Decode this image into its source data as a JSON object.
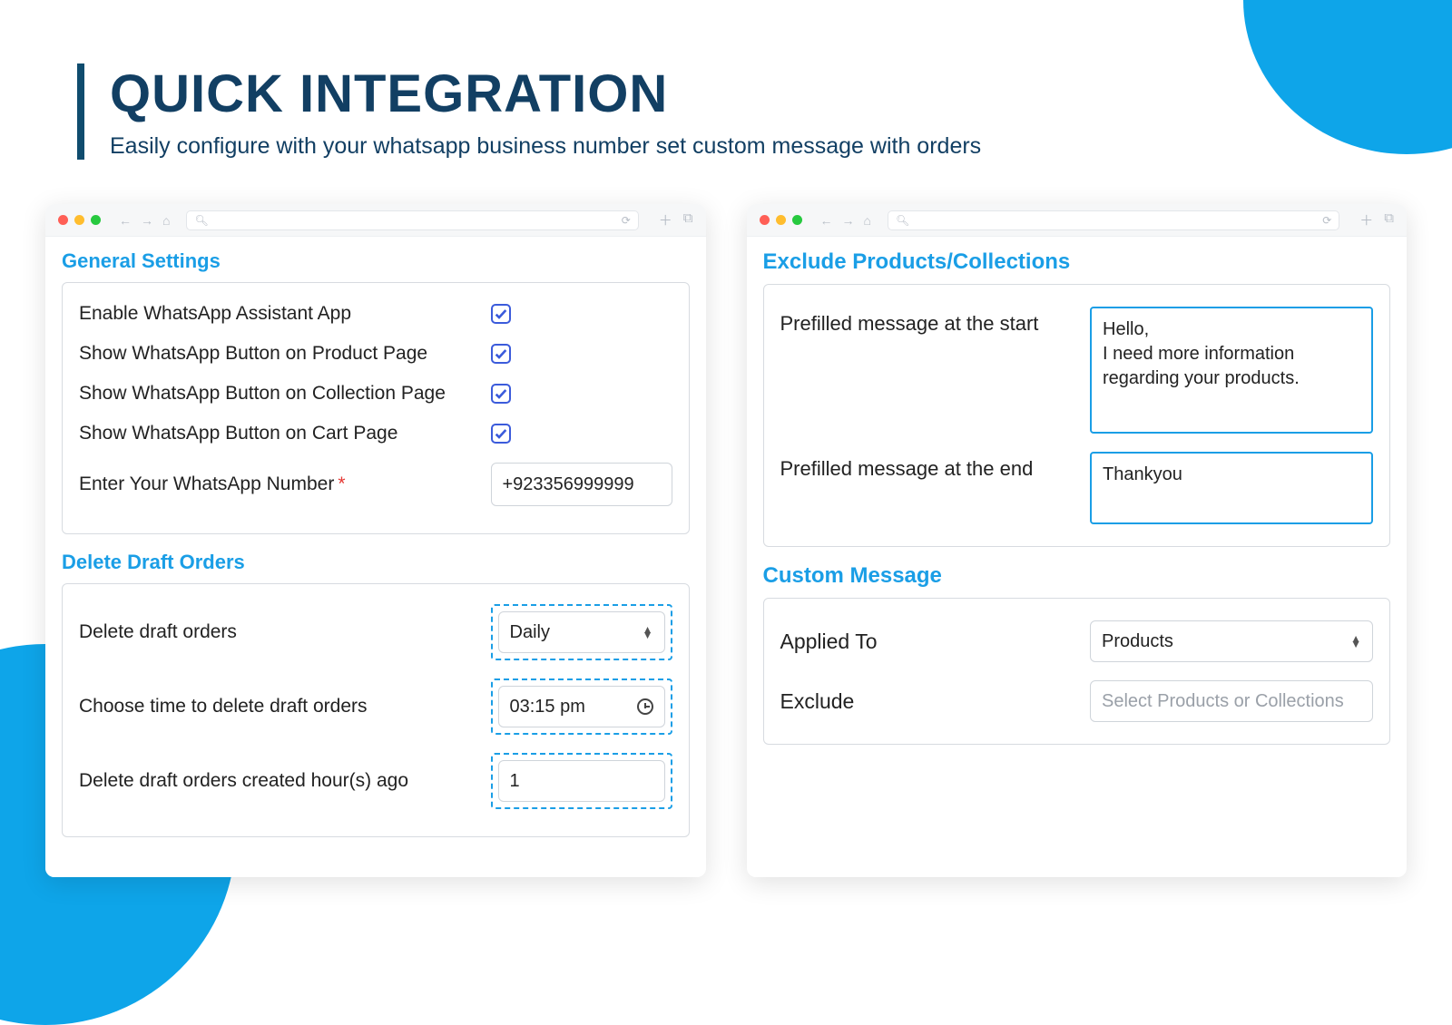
{
  "hero": {
    "title": "QUICK INTEGRATION",
    "subtitle": "Easily configure with your whatsapp business number set custom message with orders"
  },
  "left": {
    "general": {
      "title": "General Settings",
      "items": [
        {
          "label": "Enable WhatsApp Assistant App",
          "checked": true
        },
        {
          "label": "Show WhatsApp Button on Product Page",
          "checked": true
        },
        {
          "label": "Show WhatsApp Button on Collection Page",
          "checked": true
        },
        {
          "label": "Show WhatsApp Button on Cart Page",
          "checked": true
        }
      ],
      "number_label": "Enter Your WhatsApp Number",
      "number_value": "+923356999999"
    },
    "delete": {
      "title": "Delete Draft Orders",
      "freq_label": "Delete draft orders",
      "freq_value": "Daily",
      "time_label": "Choose time to delete draft orders",
      "time_value": "03:15 pm",
      "hours_label": "Delete draft orders created hour(s) ago",
      "hours_value": "1"
    }
  },
  "right": {
    "exclude": {
      "title": "Exclude Products/Collections",
      "start_label": "Prefilled message at the start",
      "start_value": "Hello,\nI need more information regarding your products.",
      "end_label": "Prefilled message at the end",
      "end_value": "Thankyou"
    },
    "custom": {
      "title": "Custom Message",
      "applied_label": "Applied To",
      "applied_value": "Products",
      "exclude_label": "Exclude",
      "exclude_placeholder": "Select Products or Collections"
    }
  }
}
